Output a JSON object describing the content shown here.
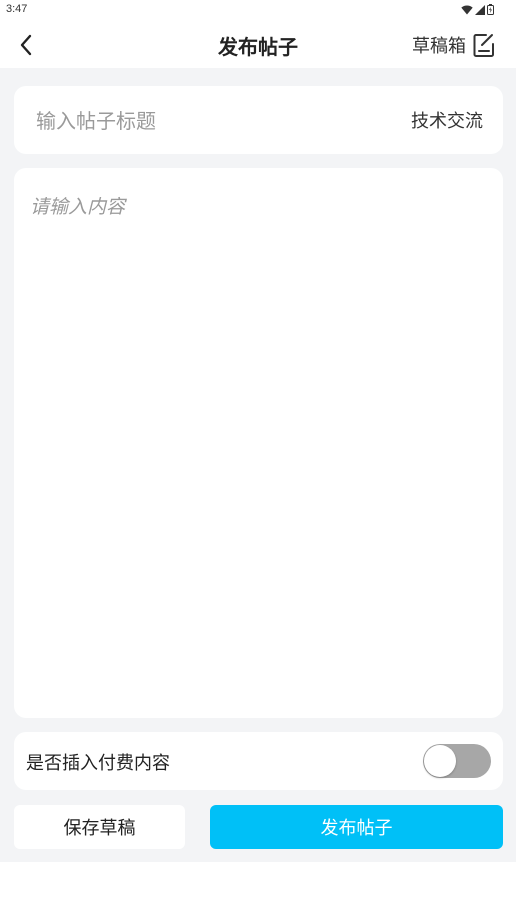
{
  "status_bar": {
    "time": "3:47",
    "icons": [
      "wifi-icon",
      "signal-icon",
      "battery-icon"
    ]
  },
  "header": {
    "title": "发布帖子",
    "back_icon": "chevron-left-icon",
    "drafts_label": "草稿箱",
    "drafts_icon": "edit-note-icon"
  },
  "post_form": {
    "title_placeholder": "输入帖子标题",
    "title_value": "",
    "category": "技术交流",
    "content_placeholder": "请输入内容",
    "content_value": ""
  },
  "paid_option": {
    "label": "是否插入付费内容",
    "enabled": false
  },
  "actions": {
    "save_draft_label": "保存草稿",
    "publish_label": "发布帖子"
  },
  "colors": {
    "accent": "#00c0f7",
    "page_background": "#f3f4f6",
    "toggle_off": "#a7a7a7"
  }
}
